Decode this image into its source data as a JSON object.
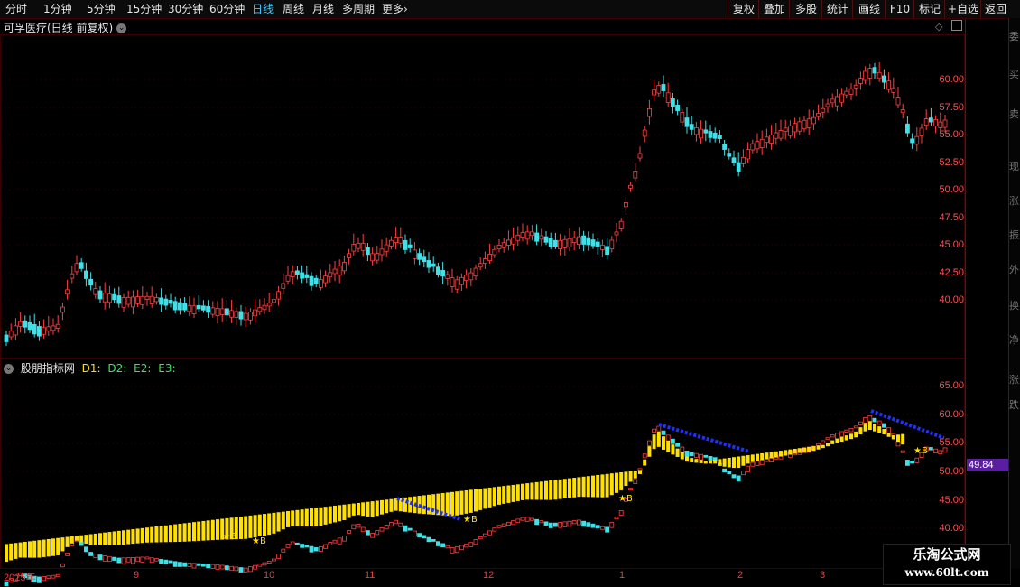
{
  "toolbar": {
    "tabs": [
      "分时",
      "1分钟",
      "5分钟",
      "15分钟",
      "30分钟",
      "60分钟",
      "日线",
      "周线",
      "月线",
      "多周期",
      "更多"
    ],
    "active_tab": "日线",
    "more_arrow": "›",
    "right_buttons": [
      "复权",
      "叠加",
      "多股",
      "统计",
      "画线",
      "F10",
      "标记",
      "+自选",
      "返回"
    ]
  },
  "chart": {
    "title": "可孚医疗(日线 前复权)",
    "price_axis": [
      "60.00",
      "57.50",
      "55.00",
      "52.50",
      "50.00",
      "47.50",
      "45.00",
      "42.50",
      "40.00"
    ],
    "indicator_name": "股朋指标网",
    "indicator_lines": [
      "D1:",
      "D2:",
      "E2:",
      "E3:"
    ],
    "indicator_axis": [
      "65.00",
      "60.00",
      "55.00",
      "50.00",
      "45.00",
      "40.00"
    ],
    "current_value": "49.84",
    "x_labels": [
      "2025年",
      "9",
      "10",
      "11",
      "12",
      "1",
      "2",
      "3"
    ],
    "buy_marks": [
      "★B",
      "★B",
      "★B",
      "★B",
      "★B"
    ]
  },
  "right_panel_chars": [
    "委",
    "买",
    "卖",
    "现",
    "涨",
    "振",
    "外",
    "换",
    "净",
    "涨",
    "跌"
  ],
  "watermark": {
    "line1": "乐淘公式网",
    "line2": "www.60lt.com"
  },
  "colors": {
    "up": "#ff4040",
    "down": "#40e0e8",
    "yellow": "#ffe000",
    "blue": "#2030ff",
    "grid": "#3a0000"
  }
}
